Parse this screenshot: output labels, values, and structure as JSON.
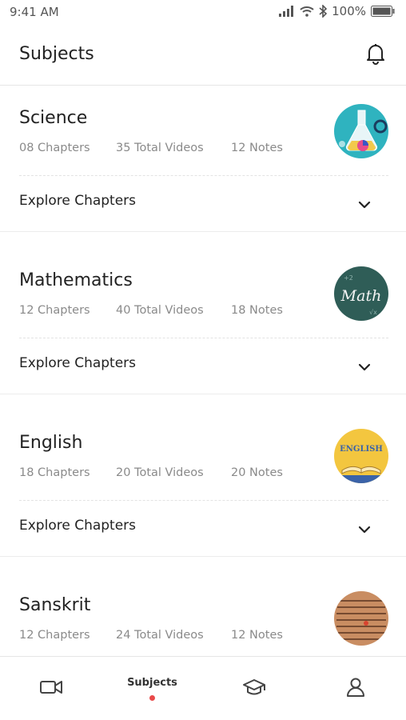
{
  "status_bar": {
    "time": "9:41 AM",
    "battery": "100%",
    "icons": [
      "signal-icon",
      "wifi-icon",
      "bluetooth-icon",
      "battery-icon"
    ]
  },
  "header": {
    "title": "Subjects",
    "icon": "bell-icon"
  },
  "subjects": [
    {
      "name": "Science",
      "chapters": "08 Chapters",
      "videos": "35 Total Videos",
      "notes": "12 Notes",
      "explore_label": "Explore Chapters",
      "thumb_icon": "science-flask-icon"
    },
    {
      "name": "Mathematics",
      "chapters": "12 Chapters",
      "videos": "40 Total Videos",
      "notes": "18 Notes",
      "explore_label": "Explore Chapters",
      "thumb_icon": "math-chalkboard-icon",
      "thumb_text": "Math"
    },
    {
      "name": "English",
      "chapters": "18 Chapters",
      "videos": "20 Total Videos",
      "notes": "20 Notes",
      "explore_label": "Explore Chapters",
      "thumb_icon": "english-book-icon",
      "thumb_text": "ENGLISH"
    },
    {
      "name": "Sanskrit",
      "chapters": "12 Chapters",
      "videos": "24 Total Videos",
      "notes": "12 Notes",
      "thumb_icon": "sanskrit-manuscript-icon"
    }
  ],
  "bottom_nav": {
    "items": [
      {
        "icon": "video-camera-icon",
        "label": ""
      },
      {
        "icon": "",
        "label": "Subjects",
        "active": true
      },
      {
        "icon": "graduation-cap-icon",
        "label": ""
      },
      {
        "icon": "user-profile-icon",
        "label": ""
      }
    ],
    "active_color": "#e94a4a"
  }
}
